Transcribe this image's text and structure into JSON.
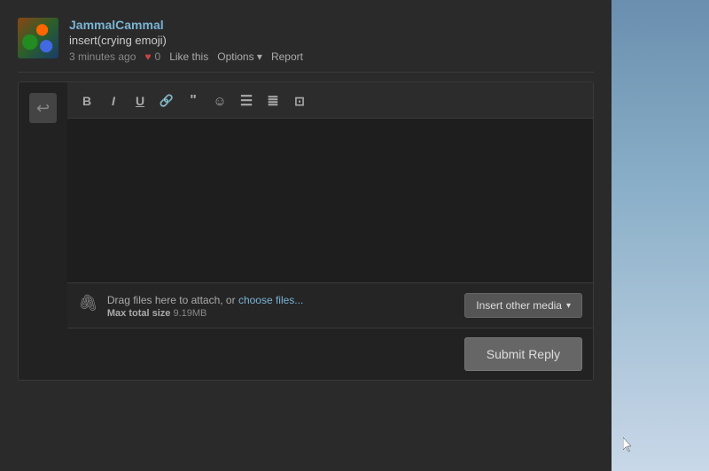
{
  "background": {
    "sky_gradient_start": "#6a8faf",
    "sky_gradient_end": "#c8d8e8"
  },
  "comment": {
    "username": "JammalCammal",
    "text": "insert(crying emoji)",
    "timestamp": "3 minutes ago",
    "likes_count": "0",
    "like_label": "Like this",
    "options_label": "Options",
    "report_label": "Report"
  },
  "editor": {
    "toolbar": {
      "bold_label": "B",
      "italic_label": "I",
      "underline_label": "U",
      "link_label": "🔗",
      "quote_label": "❝",
      "emoji_label": "☺",
      "list_unordered_label": "≡",
      "list_ordered_label": "≣",
      "image_label": "🖼"
    },
    "placeholder": ""
  },
  "attach": {
    "instruction": "Drag files here to attach, or ",
    "choose_files": "choose files...",
    "max_size_label": "Max total size",
    "max_size_value": "9.19MB"
  },
  "buttons": {
    "insert_media": "Insert other media",
    "submit_reply": "Submit Reply"
  }
}
